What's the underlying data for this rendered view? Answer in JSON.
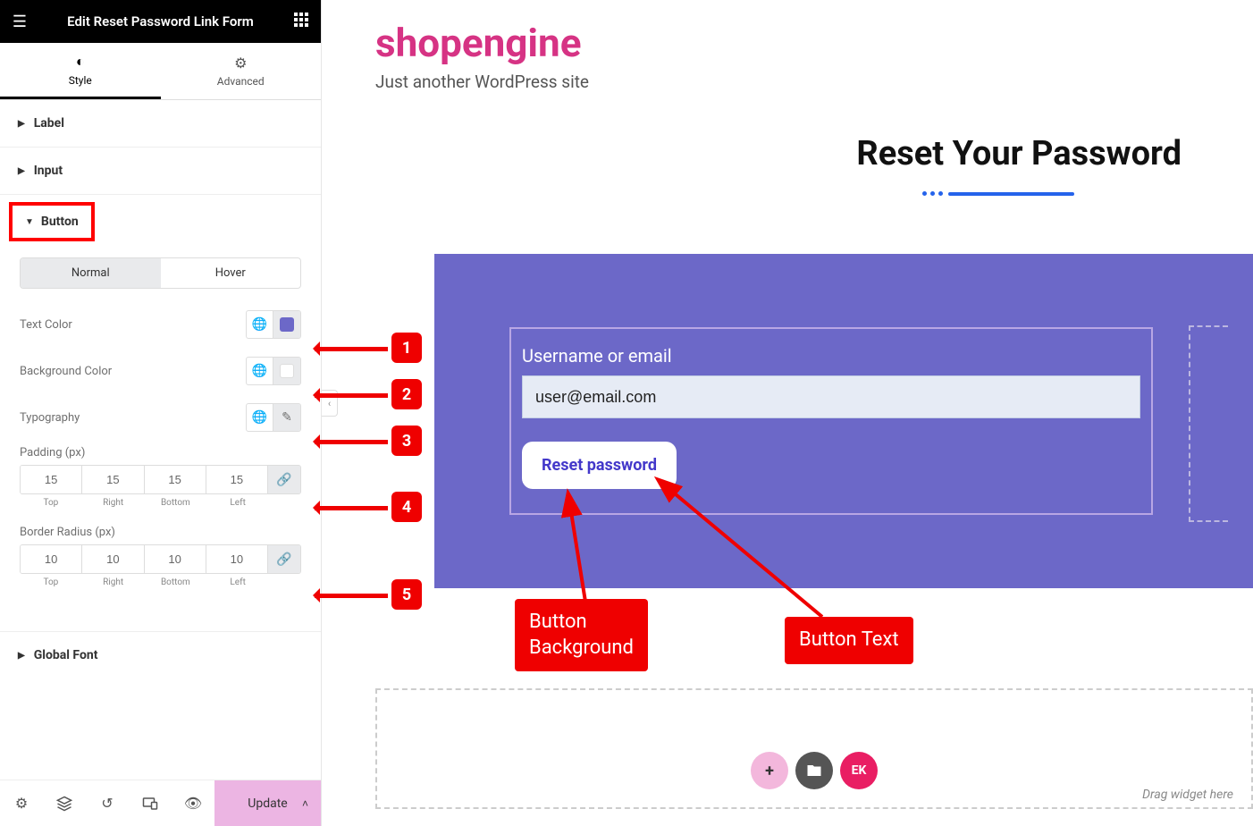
{
  "header": {
    "title": "Edit Reset Password Link Form"
  },
  "tabs": {
    "style": "Style",
    "advanced": "Advanced"
  },
  "sections": {
    "label": "Label",
    "input": "Input",
    "button": "Button",
    "global_font": "Global Font"
  },
  "button_panel": {
    "normal": "Normal",
    "hover": "Hover",
    "text_color_label": "Text Color",
    "text_color": "#6c68c8",
    "bg_color_label": "Background Color",
    "bg_color": "#ffffff",
    "typography_label": "Typography",
    "padding_label": "Padding (px)",
    "padding": {
      "top": "15",
      "right": "15",
      "bottom": "15",
      "left": "15"
    },
    "radius_label": "Border Radius (px)",
    "radius": {
      "top": "10",
      "right": "10",
      "bottom": "10",
      "left": "10"
    },
    "edges": {
      "top": "Top",
      "right": "Right",
      "bottom": "Bottom",
      "left": "Left"
    }
  },
  "bottom": {
    "update": "Update"
  },
  "preview": {
    "brand": "shopengine",
    "tagline": "Just another WordPress site",
    "heading": "Reset Your Password",
    "form_label": "Username or email",
    "form_value": "user@email.com",
    "reset_button": "Reset password",
    "drag_hint": "Drag widget here",
    "ek": "EK"
  },
  "annotations": {
    "b1": "1",
    "b2": "2",
    "b3": "3",
    "b4": "4",
    "b5": "5",
    "btn_bg": "Button\nBackground",
    "btn_text": "Button Text"
  }
}
